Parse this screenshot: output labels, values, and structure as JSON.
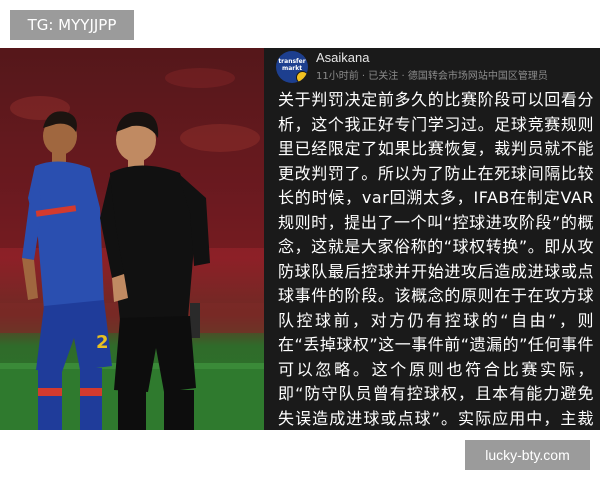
{
  "watermark": {
    "top": "TG: MYYJJPP",
    "bottom": "lucky-bty.com"
  },
  "post": {
    "avatar_logo": "transfer markt",
    "username": "Asaikana",
    "time": "11小时前",
    "separator": "·",
    "follow_status": "已关注",
    "group": "德国转会市场网站中国区管理员",
    "body": "关于判罚决定前多久的比赛阶段可以回看分析，这个我正好专门学习过。足球竞赛规则里已经限定了如果比赛恢复，裁判员就不能更改判罚了。所以为了防止在死球间隔比较长的时候，var回溯太多，IFAB在制定VAR规则时，提出了一个叫“控球进攻阶段”的概念，这就是大家俗称的“球权转换”。即从攻防球队最后控球并开始进攻后造成进球或点球事件的阶段。该概念的原则在于在攻方球队控球前，对方仍有控球的“自由”，则在“丢掉球权”这一事件前“遗漏的”任何事件可以忽略。这个原则也符合比赛实际，即“防守队员曾有控球权，且本有能力避免失误造成进球或点球”。实际应用中，主裁判和var共同协作来判定控球进攻阶段的起始点。"
  },
  "photo": {
    "jersey_number": "2"
  },
  "colors": {
    "panel_bg": "#1a1a1a",
    "watermark_bg": "#9b9b9b",
    "player_kit": "#2a4fb0",
    "referee_kit": "#111111"
  }
}
